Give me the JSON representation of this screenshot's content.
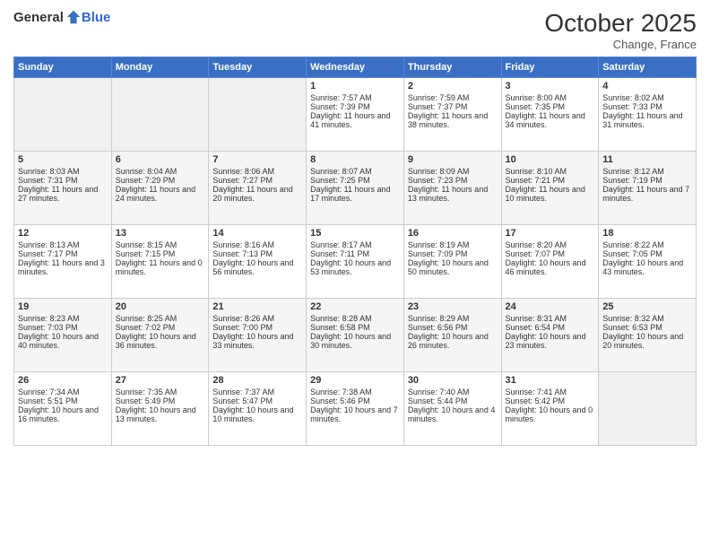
{
  "header": {
    "logo_general": "General",
    "logo_blue": "Blue",
    "month": "October 2025",
    "location": "Change, France"
  },
  "days_of_week": [
    "Sunday",
    "Monday",
    "Tuesday",
    "Wednesday",
    "Thursday",
    "Friday",
    "Saturday"
  ],
  "weeks": [
    [
      {
        "day": "",
        "content": ""
      },
      {
        "day": "",
        "content": ""
      },
      {
        "day": "",
        "content": ""
      },
      {
        "day": "1",
        "content": "Sunrise: 7:57 AM\nSunset: 7:39 PM\nDaylight: 11 hours and 41 minutes."
      },
      {
        "day": "2",
        "content": "Sunrise: 7:59 AM\nSunset: 7:37 PM\nDaylight: 11 hours and 38 minutes."
      },
      {
        "day": "3",
        "content": "Sunrise: 8:00 AM\nSunset: 7:35 PM\nDaylight: 11 hours and 34 minutes."
      },
      {
        "day": "4",
        "content": "Sunrise: 8:02 AM\nSunset: 7:33 PM\nDaylight: 11 hours and 31 minutes."
      }
    ],
    [
      {
        "day": "5",
        "content": "Sunrise: 8:03 AM\nSunset: 7:31 PM\nDaylight: 11 hours and 27 minutes."
      },
      {
        "day": "6",
        "content": "Sunrise: 8:04 AM\nSunset: 7:29 PM\nDaylight: 11 hours and 24 minutes."
      },
      {
        "day": "7",
        "content": "Sunrise: 8:06 AM\nSunset: 7:27 PM\nDaylight: 11 hours and 20 minutes."
      },
      {
        "day": "8",
        "content": "Sunrise: 8:07 AM\nSunset: 7:25 PM\nDaylight: 11 hours and 17 minutes."
      },
      {
        "day": "9",
        "content": "Sunrise: 8:09 AM\nSunset: 7:23 PM\nDaylight: 11 hours and 13 minutes."
      },
      {
        "day": "10",
        "content": "Sunrise: 8:10 AM\nSunset: 7:21 PM\nDaylight: 11 hours and 10 minutes."
      },
      {
        "day": "11",
        "content": "Sunrise: 8:12 AM\nSunset: 7:19 PM\nDaylight: 11 hours and 7 minutes."
      }
    ],
    [
      {
        "day": "12",
        "content": "Sunrise: 8:13 AM\nSunset: 7:17 PM\nDaylight: 11 hours and 3 minutes."
      },
      {
        "day": "13",
        "content": "Sunrise: 8:15 AM\nSunset: 7:15 PM\nDaylight: 11 hours and 0 minutes."
      },
      {
        "day": "14",
        "content": "Sunrise: 8:16 AM\nSunset: 7:13 PM\nDaylight: 10 hours and 56 minutes."
      },
      {
        "day": "15",
        "content": "Sunrise: 8:17 AM\nSunset: 7:11 PM\nDaylight: 10 hours and 53 minutes."
      },
      {
        "day": "16",
        "content": "Sunrise: 8:19 AM\nSunset: 7:09 PM\nDaylight: 10 hours and 50 minutes."
      },
      {
        "day": "17",
        "content": "Sunrise: 8:20 AM\nSunset: 7:07 PM\nDaylight: 10 hours and 46 minutes."
      },
      {
        "day": "18",
        "content": "Sunrise: 8:22 AM\nSunset: 7:05 PM\nDaylight: 10 hours and 43 minutes."
      }
    ],
    [
      {
        "day": "19",
        "content": "Sunrise: 8:23 AM\nSunset: 7:03 PM\nDaylight: 10 hours and 40 minutes."
      },
      {
        "day": "20",
        "content": "Sunrise: 8:25 AM\nSunset: 7:02 PM\nDaylight: 10 hours and 36 minutes."
      },
      {
        "day": "21",
        "content": "Sunrise: 8:26 AM\nSunset: 7:00 PM\nDaylight: 10 hours and 33 minutes."
      },
      {
        "day": "22",
        "content": "Sunrise: 8:28 AM\nSunset: 6:58 PM\nDaylight: 10 hours and 30 minutes."
      },
      {
        "day": "23",
        "content": "Sunrise: 8:29 AM\nSunset: 6:56 PM\nDaylight: 10 hours and 26 minutes."
      },
      {
        "day": "24",
        "content": "Sunrise: 8:31 AM\nSunset: 6:54 PM\nDaylight: 10 hours and 23 minutes."
      },
      {
        "day": "25",
        "content": "Sunrise: 8:32 AM\nSunset: 6:53 PM\nDaylight: 10 hours and 20 minutes."
      }
    ],
    [
      {
        "day": "26",
        "content": "Sunrise: 7:34 AM\nSunset: 5:51 PM\nDaylight: 10 hours and 16 minutes."
      },
      {
        "day": "27",
        "content": "Sunrise: 7:35 AM\nSunset: 5:49 PM\nDaylight: 10 hours and 13 minutes."
      },
      {
        "day": "28",
        "content": "Sunrise: 7:37 AM\nSunset: 5:47 PM\nDaylight: 10 hours and 10 minutes."
      },
      {
        "day": "29",
        "content": "Sunrise: 7:38 AM\nSunset: 5:46 PM\nDaylight: 10 hours and 7 minutes."
      },
      {
        "day": "30",
        "content": "Sunrise: 7:40 AM\nSunset: 5:44 PM\nDaylight: 10 hours and 4 minutes."
      },
      {
        "day": "31",
        "content": "Sunrise: 7:41 AM\nSunset: 5:42 PM\nDaylight: 10 hours and 0 minutes."
      },
      {
        "day": "",
        "content": ""
      }
    ]
  ]
}
